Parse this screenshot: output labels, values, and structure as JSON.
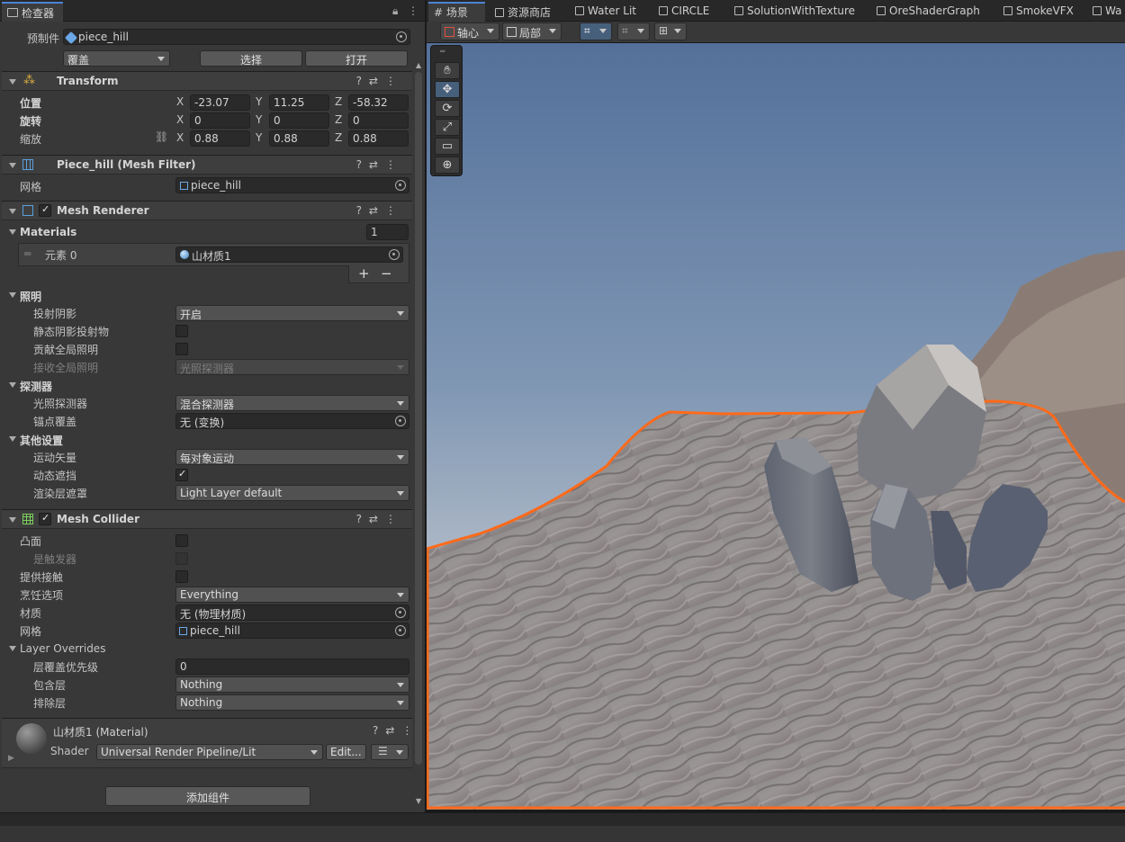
{
  "inspector": {
    "tab_label": "检查器",
    "prefab": {
      "label": "预制件",
      "value": "piece_hill",
      "override": "覆盖",
      "select": "选择",
      "open": "打开"
    },
    "transform": {
      "title": "Transform",
      "position": {
        "label": "位置",
        "x": "-23.07",
        "y": "11.25",
        "z": "-58.32"
      },
      "rotation": {
        "label": "旋转",
        "x": "0",
        "y": "0",
        "z": "0"
      },
      "scale": {
        "label": "缩放",
        "x": "0.88",
        "y": "0.88",
        "z": "0.88"
      }
    },
    "mesh_filter": {
      "title": "Piece_hill (Mesh Filter)",
      "mesh_label": "网格",
      "mesh_value": "piece_hill"
    },
    "mesh_renderer": {
      "title": "Mesh Renderer",
      "materials_label": "Materials",
      "materials_count": "1",
      "element_label": "元素 0",
      "element_value": "山材质1",
      "lighting": {
        "section": "照明",
        "cast_shadows": {
          "label": "投射阴影",
          "value": "开启"
        },
        "static_shadow": {
          "label": "静态阴影投射物"
        },
        "contribute_gi": {
          "label": "贡献全局照明"
        },
        "receive_gi": {
          "label": "接收全局照明",
          "value": "光照探测器"
        }
      },
      "probes": {
        "section": "探测器",
        "light_probes": {
          "label": "光照探测器",
          "value": "混合探测器"
        },
        "anchor": {
          "label": "锚点覆盖",
          "value": "无 (变换)"
        }
      },
      "other": {
        "section": "其他设置",
        "motion_vectors": {
          "label": "运动矢量",
          "value": "每对象运动"
        },
        "dynamic_occlusion": {
          "label": "动态遮挡"
        },
        "rendering_layer": {
          "label": "渲染层遮罩",
          "value": "Light Layer default"
        }
      }
    },
    "mesh_collider": {
      "title": "Mesh Collider",
      "convex": {
        "label": "凸面"
      },
      "is_trigger": {
        "label": "是触发器"
      },
      "provides_contacts": {
        "label": "提供接触"
      },
      "cooking": {
        "label": "烹饪选项",
        "value": "Everything"
      },
      "material": {
        "label": "材质",
        "value": "无 (物理材质)"
      },
      "mesh": {
        "label": "网格",
        "value": "piece_hill"
      },
      "layer_overrides": {
        "section": "Layer Overrides",
        "priority": {
          "label": "层覆盖优先级",
          "value": "0"
        },
        "include": {
          "label": "包含层",
          "value": "Nothing"
        },
        "exclude": {
          "label": "排除层",
          "value": "Nothing"
        }
      }
    },
    "material": {
      "title": "山材质1 (Material)",
      "shader_label": "Shader",
      "shader_value": "Universal Render Pipeline/Lit",
      "edit": "Edit..."
    },
    "add_component": "添加组件"
  },
  "scene": {
    "tabs": [
      "场景",
      "资源商店",
      "Water Lit",
      "CIRCLE",
      "SolutionWithTexture",
      "OreShaderGraph",
      "SmokeVFX",
      "Wa"
    ],
    "pivot": "轴心",
    "local": "局部"
  },
  "colors": {
    "accent": "#4e83d8",
    "selection_outline": "#ff6a1a",
    "panel": "#383838",
    "sky_top": "#5a7398",
    "sky_bottom": "#b9c2cd"
  }
}
